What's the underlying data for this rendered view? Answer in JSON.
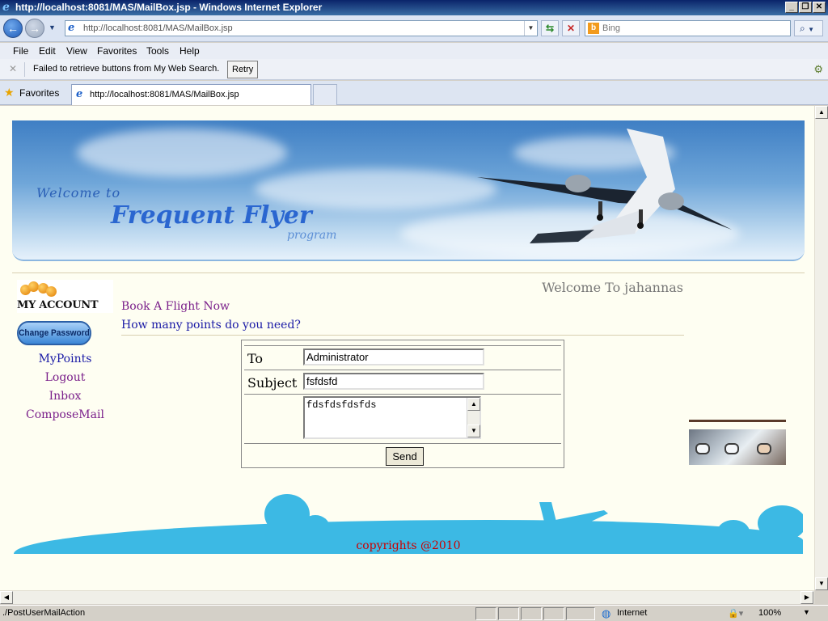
{
  "window": {
    "title": "http://localhost:8081/MAS/MailBox.jsp - Windows Internet Explorer",
    "minimize": "_",
    "restore": "❐",
    "close": "✕"
  },
  "address_bar": {
    "url": "http://localhost:8081/MAS/MailBox.jsp",
    "search_placeholder": "Bing"
  },
  "menu": {
    "items": [
      "File",
      "Edit",
      "View",
      "Favorites",
      "Tools",
      "Help"
    ]
  },
  "info_bar": {
    "message": "Failed to retrieve buttons from My Web Search.",
    "retry_label": "Retry"
  },
  "favorites_bar": {
    "favorites_label": "Favorites",
    "tab_title": "http://localhost:8081/MAS/MailBox.jsp"
  },
  "banner": {
    "welcome": "Welcome to",
    "program_name": "Frequent Flyer",
    "program": "program"
  },
  "account": {
    "logo_text": "MY ACCOUNT",
    "change_password": "Change Password",
    "nav": [
      "MyPoints",
      "Logout",
      "Inbox",
      "ComposeMail"
    ]
  },
  "main": {
    "welcome_user": "Welcome To jahannas",
    "links": [
      "Book A Flight Now",
      "How many points do you need?"
    ]
  },
  "mail_form": {
    "to_label": "To",
    "to_value": "Administrator",
    "subject_label": "Subject",
    "subject_value": "fsfdsfd",
    "body_value": "fdsfdsfdsfds",
    "send_label": "Send"
  },
  "footer": {
    "copyright": "copyrights @2010"
  },
  "status_bar": {
    "status_text": "./PostUserMailAction",
    "zone": "Internet",
    "zoom": "100%"
  },
  "colors": {
    "page_bg": "#fefef2",
    "link_purple": "#7a1f8a",
    "link_blue": "#1a1aa6",
    "copyright_red": "#cc0000",
    "footer_band": "#3cb9e4"
  }
}
